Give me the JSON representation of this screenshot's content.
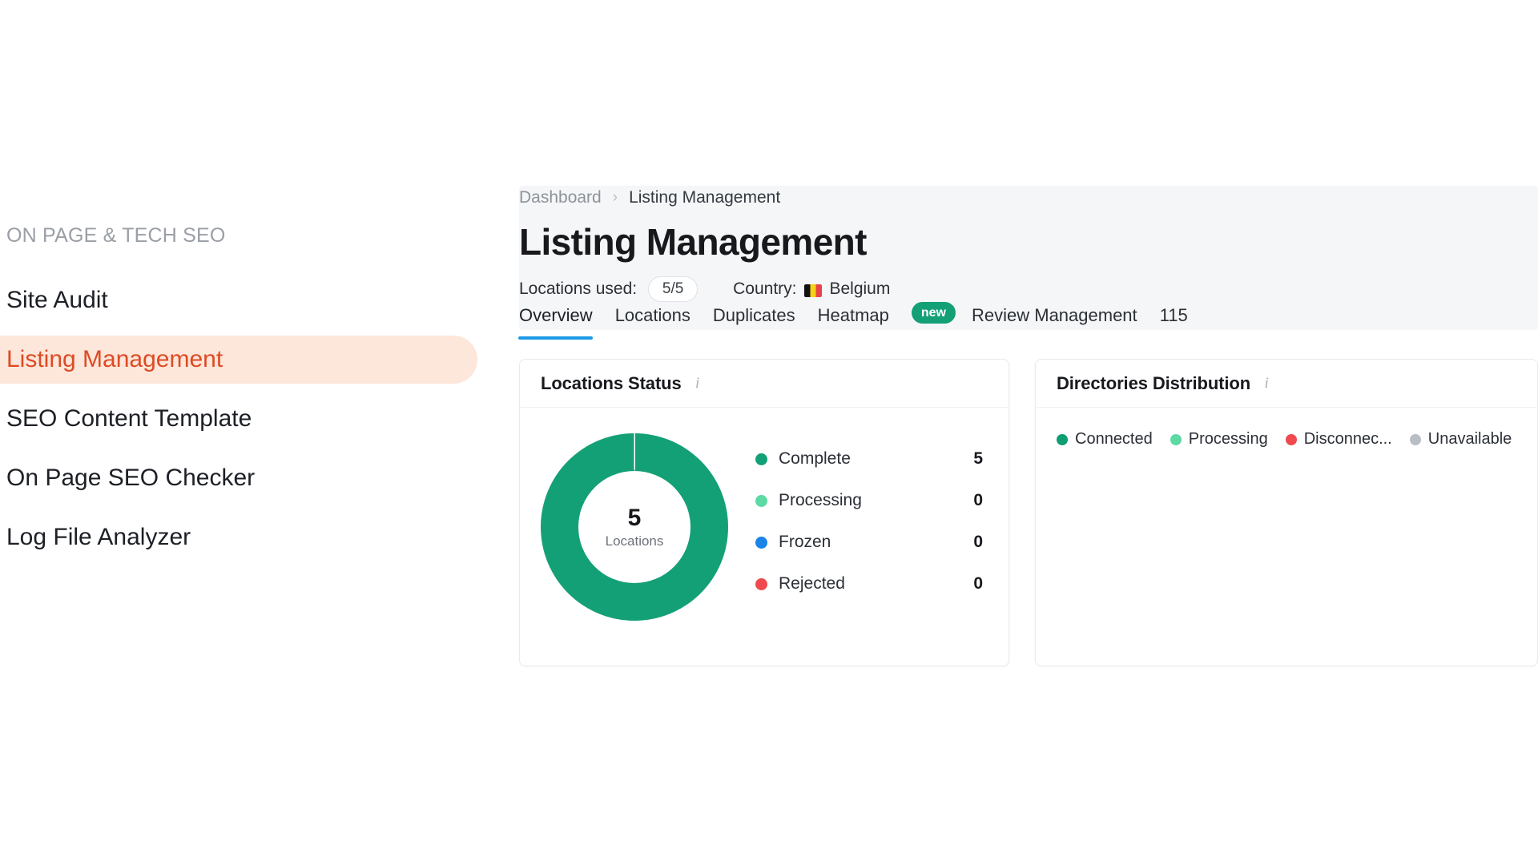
{
  "sidebar": {
    "section_title": "ON PAGE & TECH SEO",
    "items": [
      {
        "label": "Site Audit",
        "active": false
      },
      {
        "label": "Listing Management",
        "active": true
      },
      {
        "label": "SEO Content Template",
        "active": false
      },
      {
        "label": "On Page SEO Checker",
        "active": false
      },
      {
        "label": "Log File Analyzer",
        "active": false
      }
    ],
    "active_bg": "#fde6da",
    "active_color": "#dd4b24"
  },
  "breadcrumb": {
    "root": "Dashboard",
    "separator": "›",
    "current": "Listing Management"
  },
  "header": {
    "title": "Listing Management",
    "locations_label": "Locations used:",
    "locations_value": "5/5",
    "country_label": "Country:",
    "country_name": "Belgium",
    "country_flag": "belgium-flag-icon"
  },
  "tabs": {
    "items": [
      {
        "label": "Overview",
        "active": true
      },
      {
        "label": "Locations",
        "active": false
      },
      {
        "label": "Duplicates",
        "active": false
      },
      {
        "label": "Heatmap",
        "active": false
      },
      {
        "label": "Review Management",
        "active": false
      }
    ],
    "new_badge": "new",
    "review_count": "115",
    "active_underline_color": "#1c9ae6",
    "badge_color": "#14a077"
  },
  "cards": {
    "locations_status": {
      "title": "Locations Status",
      "info_icon": "info-icon",
      "donut_center_value": "5",
      "donut_center_caption": "Locations",
      "legend": [
        {
          "label": "Complete",
          "value": "5",
          "color": "#14a077"
        },
        {
          "label": "Processing",
          "value": "0",
          "color": "#5ddaa4"
        },
        {
          "label": "Frozen",
          "value": "0",
          "color": "#1a84e8"
        },
        {
          "label": "Rejected",
          "value": "0",
          "color": "#f0494f"
        }
      ]
    },
    "directories_distribution": {
      "title": "Directories Distribution",
      "info_icon": "info-icon",
      "legend": [
        {
          "label": "Connected",
          "color": "#0e9e72"
        },
        {
          "label": "Processing",
          "color": "#5ddaa4"
        },
        {
          "label": "Disconnec...",
          "color": "#f0494f"
        },
        {
          "label": "Unavailable",
          "color": "#b9bdc6"
        }
      ]
    }
  },
  "chart_data": {
    "type": "pie",
    "title": "Locations Status",
    "labels": [
      "Complete",
      "Processing",
      "Frozen",
      "Rejected"
    ],
    "values": [
      5,
      0,
      0,
      0
    ],
    "colors": [
      "#14a077",
      "#5ddaa4",
      "#1a84e8",
      "#f0494f"
    ],
    "total": 5,
    "center_label": "Locations",
    "legend_position": "right",
    "donut": true
  }
}
